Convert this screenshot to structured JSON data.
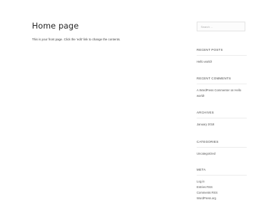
{
  "main": {
    "title": "Home page",
    "body_text": "This is your front page. Click the 'edit' link to change the contents."
  },
  "sidebar": {
    "search": {
      "placeholder": "Search ..."
    },
    "recent_posts": {
      "title": "RECENT POSTS",
      "items": [
        "Hello world!"
      ]
    },
    "recent_comments": {
      "title": "RECENT COMMENTS",
      "author": "A WordPress Commenter",
      "joiner": "on",
      "post": "Hello world!"
    },
    "archives": {
      "title": "ARCHIVES",
      "items": [
        "January 2018"
      ]
    },
    "categories": {
      "title": "CATEGORIES",
      "items": [
        "Uncategorized"
      ]
    },
    "meta": {
      "title": "META",
      "items": [
        "Log in",
        "Entries RSS",
        "Comments RSS",
        "WordPress.org"
      ]
    }
  }
}
